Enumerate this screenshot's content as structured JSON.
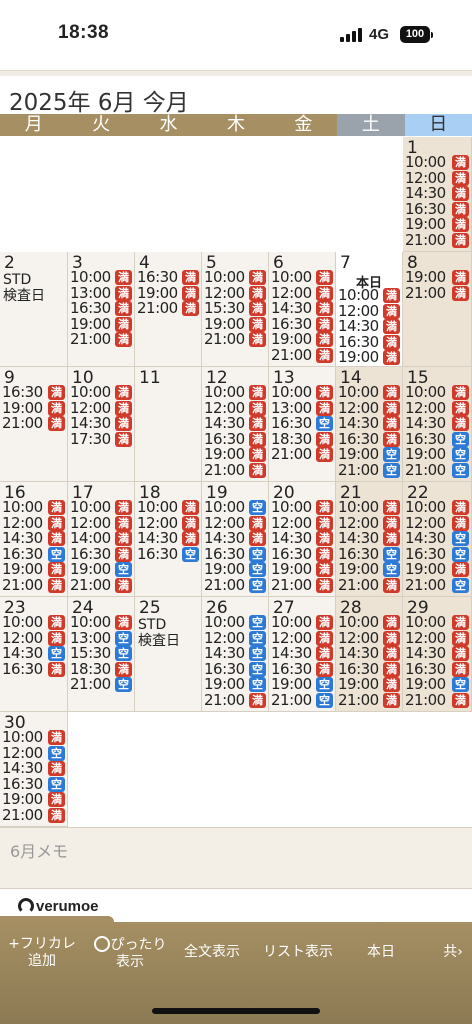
{
  "status": {
    "time": "18:38",
    "network": "4G",
    "battery": "100"
  },
  "header": {
    "title": "2025年 6月 今月"
  },
  "weekdays": [
    "月",
    "火",
    "水",
    "木",
    "金",
    "土",
    "日"
  ],
  "legend": {
    "full": "満",
    "open": "空"
  },
  "colors": {
    "full": "#d03a2a",
    "open": "#2d7ad6",
    "accent": "#a58f63"
  },
  "weeks": [
    [
      null,
      null,
      null,
      null,
      null,
      null,
      {
        "day": "1",
        "slots": [
          [
            "10:00",
            "full"
          ],
          [
            "12:00",
            "full"
          ],
          [
            "14:30",
            "full"
          ],
          [
            "16:30",
            "full"
          ],
          [
            "19:00",
            "full"
          ],
          [
            "21:00",
            "full"
          ]
        ]
      }
    ],
    [
      {
        "day": "2",
        "note": "STD\n検査日",
        "slots": []
      },
      {
        "day": "3",
        "slots": [
          [
            "10:00",
            "full"
          ],
          [
            "13:00",
            "full"
          ],
          [
            "16:30",
            "full"
          ],
          [
            "19:00",
            "full"
          ],
          [
            "21:00",
            "full"
          ]
        ]
      },
      {
        "day": "4",
        "slots": [
          [
            "16:30",
            "full"
          ],
          [
            "19:00",
            "full"
          ],
          [
            "21:00",
            "full"
          ]
        ]
      },
      {
        "day": "5",
        "slots": [
          [
            "10:00",
            "full"
          ],
          [
            "12:00",
            "full"
          ],
          [
            "15:30",
            "full"
          ],
          [
            "19:00",
            "full"
          ],
          [
            "21:00",
            "full"
          ]
        ]
      },
      {
        "day": "6",
        "slots": [
          [
            "10:00",
            "full"
          ],
          [
            "12:00",
            "full"
          ],
          [
            "14:30",
            "full"
          ],
          [
            "16:30",
            "full"
          ],
          [
            "19:00",
            "full"
          ],
          [
            "21:00",
            "full"
          ]
        ]
      },
      {
        "day": "7",
        "today": "本日",
        "slots": [
          [
            "10:00",
            "full"
          ],
          [
            "12:00",
            "full"
          ],
          [
            "14:30",
            "full"
          ],
          [
            "16:30",
            "full"
          ],
          [
            "19:00",
            "full"
          ]
        ]
      },
      {
        "day": "8",
        "slots": [
          [
            "19:00",
            "full"
          ],
          [
            "21:00",
            "full"
          ]
        ]
      }
    ],
    [
      {
        "day": "9",
        "slots": [
          [
            "16:30",
            "full"
          ],
          [
            "19:00",
            "full"
          ],
          [
            "21:00",
            "full"
          ]
        ]
      },
      {
        "day": "10",
        "slots": [
          [
            "10:00",
            "full"
          ],
          [
            "12:00",
            "full"
          ],
          [
            "14:30",
            "full"
          ],
          [
            "17:30",
            "full"
          ]
        ]
      },
      {
        "day": "11",
        "slots": []
      },
      {
        "day": "12",
        "slots": [
          [
            "10:00",
            "full"
          ],
          [
            "12:00",
            "full"
          ],
          [
            "14:30",
            "full"
          ],
          [
            "16:30",
            "full"
          ],
          [
            "19:00",
            "full"
          ],
          [
            "21:00",
            "full"
          ]
        ]
      },
      {
        "day": "13",
        "slots": [
          [
            "10:00",
            "full"
          ],
          [
            "13:00",
            "full"
          ],
          [
            "16:30",
            "open"
          ],
          [
            "18:30",
            "full"
          ],
          [
            "21:00",
            "full"
          ]
        ]
      },
      {
        "day": "14",
        "slots": [
          [
            "10:00",
            "full"
          ],
          [
            "12:00",
            "full"
          ],
          [
            "14:30",
            "full"
          ],
          [
            "16:30",
            "full"
          ],
          [
            "19:00",
            "open"
          ],
          [
            "21:00",
            "open"
          ]
        ]
      },
      {
        "day": "15",
        "slots": [
          [
            "10:00",
            "full"
          ],
          [
            "12:00",
            "full"
          ],
          [
            "14:30",
            "full"
          ],
          [
            "16:30",
            "open"
          ],
          [
            "19:00",
            "open"
          ],
          [
            "21:00",
            "open"
          ]
        ]
      }
    ],
    [
      {
        "day": "16",
        "slots": [
          [
            "10:00",
            "full"
          ],
          [
            "12:00",
            "full"
          ],
          [
            "14:30",
            "full"
          ],
          [
            "16:30",
            "open"
          ],
          [
            "19:00",
            "full"
          ],
          [
            "21:00",
            "full"
          ]
        ]
      },
      {
        "day": "17",
        "slots": [
          [
            "10:00",
            "full"
          ],
          [
            "12:00",
            "full"
          ],
          [
            "14:00",
            "full"
          ],
          [
            "16:30",
            "full"
          ],
          [
            "19:00",
            "open"
          ],
          [
            "21:00",
            "full"
          ]
        ]
      },
      {
        "day": "18",
        "slots": [
          [
            "10:00",
            "full"
          ],
          [
            "12:00",
            "full"
          ],
          [
            "14:30",
            "full"
          ],
          [
            "16:30",
            "open"
          ]
        ]
      },
      {
        "day": "19",
        "slots": [
          [
            "10:00",
            "open"
          ],
          [
            "12:00",
            "full"
          ],
          [
            "14:30",
            "full"
          ],
          [
            "16:30",
            "open"
          ],
          [
            "19:00",
            "open"
          ],
          [
            "21:00",
            "open"
          ]
        ]
      },
      {
        "day": "20",
        "slots": [
          [
            "10:00",
            "full"
          ],
          [
            "12:00",
            "full"
          ],
          [
            "14:30",
            "full"
          ],
          [
            "16:30",
            "full"
          ],
          [
            "19:00",
            "full"
          ],
          [
            "21:00",
            "full"
          ]
        ]
      },
      {
        "day": "21",
        "slots": [
          [
            "10:00",
            "full"
          ],
          [
            "12:00",
            "full"
          ],
          [
            "14:30",
            "full"
          ],
          [
            "16:30",
            "open"
          ],
          [
            "19:00",
            "open"
          ],
          [
            "21:00",
            "full"
          ]
        ]
      },
      {
        "day": "22",
        "slots": [
          [
            "10:00",
            "full"
          ],
          [
            "12:00",
            "full"
          ],
          [
            "14:30",
            "open"
          ],
          [
            "16:30",
            "open"
          ],
          [
            "19:00",
            "full"
          ],
          [
            "21:00",
            "open"
          ]
        ]
      }
    ],
    [
      {
        "day": "23",
        "slots": [
          [
            "10:00",
            "full"
          ],
          [
            "12:00",
            "full"
          ],
          [
            "14:30",
            "open"
          ],
          [
            "16:30",
            "full"
          ]
        ]
      },
      {
        "day": "24",
        "slots": [
          [
            "10:00",
            "full"
          ],
          [
            "13:00",
            "open"
          ],
          [
            "15:30",
            "open"
          ],
          [
            "18:30",
            "full"
          ],
          [
            "21:00",
            "open"
          ]
        ]
      },
      {
        "day": "25",
        "note": "STD\n検査日",
        "slots": []
      },
      {
        "day": "26",
        "slots": [
          [
            "10:00",
            "open"
          ],
          [
            "12:00",
            "open"
          ],
          [
            "14:30",
            "open"
          ],
          [
            "16:30",
            "open"
          ],
          [
            "19:00",
            "open"
          ],
          [
            "21:00",
            "full"
          ]
        ]
      },
      {
        "day": "27",
        "slots": [
          [
            "10:00",
            "full"
          ],
          [
            "12:00",
            "full"
          ],
          [
            "14:30",
            "full"
          ],
          [
            "16:30",
            "full"
          ],
          [
            "19:00",
            "open"
          ],
          [
            "21:00",
            "open"
          ]
        ]
      },
      {
        "day": "28",
        "slots": [
          [
            "10:00",
            "full"
          ],
          [
            "12:00",
            "full"
          ],
          [
            "14:30",
            "full"
          ],
          [
            "16:30",
            "full"
          ],
          [
            "19:00",
            "full"
          ],
          [
            "21:00",
            "full"
          ]
        ]
      },
      {
        "day": "29",
        "slots": [
          [
            "10:00",
            "full"
          ],
          [
            "12:00",
            "full"
          ],
          [
            "14:30",
            "full"
          ],
          [
            "16:30",
            "full"
          ],
          [
            "19:00",
            "open"
          ],
          [
            "21:00",
            "full"
          ]
        ]
      }
    ],
    [
      {
        "day": "30",
        "slots": [
          [
            "10:00",
            "full"
          ],
          [
            "12:00",
            "open"
          ],
          [
            "14:30",
            "full"
          ],
          [
            "16:30",
            "open"
          ],
          [
            "19:00",
            "full"
          ],
          [
            "21:00",
            "full"
          ]
        ]
      },
      null,
      null,
      null,
      null,
      null,
      null
    ]
  ],
  "memo": {
    "placeholder": "6月メモ"
  },
  "brand": {
    "name": "verumoe"
  },
  "toolbar": {
    "add_label": "+フリカレ\n追加",
    "fit_label": "ぴったり\n表示",
    "fulltext_label": "全文表示",
    "list_label": "リスト表示",
    "today_label": "本日",
    "share_label": "共"
  }
}
